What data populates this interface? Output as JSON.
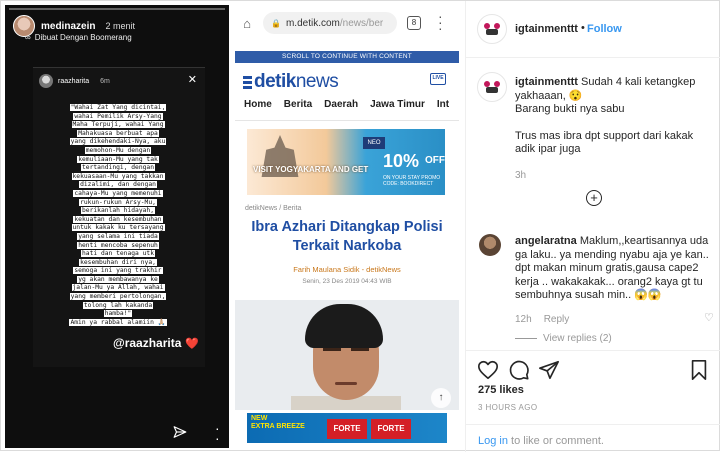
{
  "story": {
    "username": "medinazein",
    "time": "2 menit",
    "subtitle": "Dibuat Dengan Boomerang",
    "inner_username": "raazharita",
    "inner_time": "6m",
    "quote_lines": [
      "\"Wahai Zat Yang dicintai,",
      "wahai Pemilik Arsy-Yang",
      "Maha Terpuji, wahai Yang",
      "Mahakuasa berbuat apa",
      "yang dikehendaki-Nya, aku",
      "memohon-Mu dengan",
      "kemuliaan-Mu yang tak",
      "tertandingi, dengan",
      "kekuasaan-Mu yang takkan",
      "dizalimi, dan dengan",
      "cahaya-Mu yang memenuhi",
      "rukun-rukun Arsy-Mu,",
      "berikanlah hidayah,",
      "kekuatan dan kesembuhan",
      "untuk kakak ku tersayang",
      "yang selama ini tiada",
      "henti mencoba sepenuh",
      "hati dan tenaga utk",
      "kesembuhan diri nya,",
      "semoga ini yang trakhir",
      "yg akan membawanya ke",
      "jalan-Mu ya Allah, wahai",
      "yang memberi pertolongan,",
      "tolong lah kakanda",
      "hamba!\"",
      "Amin ya rabbal alamiin 🙏🏼"
    ],
    "mention": "@raazharita",
    "heart": "❤️"
  },
  "browser": {
    "url_host": "m.detik.com",
    "url_path": "/news/ber",
    "tab_count": "8",
    "scroll_banner": "SCROLL TO CONTINUE WITH CONTENT",
    "logo_main": "detik",
    "logo_tail": "news",
    "live_label": "LIVE",
    "nav": [
      "Home",
      "Berita",
      "Daerah",
      "Jawa Timur",
      "Int"
    ],
    "ad": {
      "neo": "NEO",
      "visit": "VISIT YOGYAKARTA AND GET",
      "percent": "10%",
      "off": "OFF",
      "small": "ON YOUR STAY  PROMO CODE: BOOKDIRECT"
    },
    "breadcrumb": "detikNews / Berita",
    "headline": "Ibra Azhari Ditangkap Polisi Terkait Narkoba",
    "byline": "Farih Maulana Sidik - detikNews",
    "dateline": "Senin, 23 Des 2019 04:43 WIB",
    "ad2": {
      "new": "NEW",
      "sub": "EXTRA BREEZE",
      "brand": "FORTE",
      "brand2": "FORTE"
    }
  },
  "instagram": {
    "username": "igtainmenttt",
    "follow_label": "Follow",
    "caption_user": "igtainmenttt",
    "caption_lines": [
      "Sudah 4 kali ketangkep",
      "yakhaaan, 😯",
      "Barang bukti nya sabu",
      "",
      "Trus mas ibra dpt support dari kakak",
      "adik ipar juga"
    ],
    "caption_time": "3h",
    "comment_user": "angelaratna",
    "comment_lines": [
      "Maklum,,keartisannya uda",
      "ga laku.. ya mending nyabu aja ye kan..",
      "dpt makan minum gratis,gausa cape2",
      "kerja .. wakakakak... orang2 kaya gt tu",
      "sembuhnya susah min.. 😱😱"
    ],
    "comment_time": "12h",
    "reply_label": "Reply",
    "view_replies": "View replies (2)",
    "likes": "275 likes",
    "ago": "3 HOURS AGO",
    "login_link": "Log in",
    "login_rest": " to like or comment."
  }
}
